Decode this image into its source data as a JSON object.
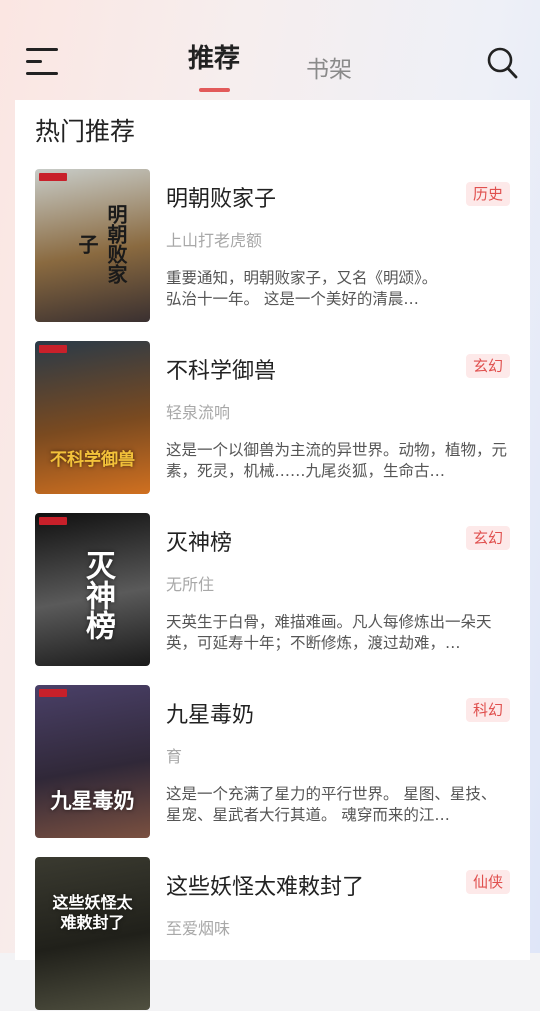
{
  "header": {
    "tabs": [
      {
        "label": "推荐",
        "active": true
      },
      {
        "label": "书架",
        "active": false
      }
    ],
    "accent_color": "#e25a5a"
  },
  "section": {
    "title": "热门推荐"
  },
  "books": [
    {
      "title": "明朝败家子",
      "author": "上山打老虎额",
      "tag": "历史",
      "desc": "重要通知，明朝败家子，又名《明颂》。\n        弘治十一年。        这是一个美好的清晨…",
      "cover_text": "明朝败家子",
      "cover_colors": [
        "#c8ccc8",
        "#8a6a40",
        "#3a3030"
      ]
    },
    {
      "title": "不科学御兽",
      "author": "轻泉流响",
      "tag": "玄幻",
      "desc": "这是一个以御兽为主流的异世界。动物，植物，元素，死灵，机械……九尾炎狐，生命古…",
      "cover_text": "不科学御兽",
      "cover_colors": [
        "#2a3a48",
        "#7a4a20",
        "#d07020"
      ]
    },
    {
      "title": "灭神榜",
      "author": "无所住",
      "tag": "玄幻",
      "desc": "天英生于白骨，难描难画。凡人每修炼出一朵天英，可延寿十年；不断修炼，渡过劫难，…",
      "cover_text": "灭神榜",
      "cover_colors": [
        "#101010",
        "#5a5a5a",
        "#1a1a1a"
      ]
    },
    {
      "title": "九星毒奶",
      "author": "育",
      "tag": "科幻",
      "desc": "这是一个充满了星力的平行世界。 星图、星技、星宠、星武者大行其道。 魂穿而来的江…",
      "cover_text": "九星毒奶",
      "cover_colors": [
        "#4a4068",
        "#302838",
        "#7a5040"
      ]
    },
    {
      "title": "这些妖怪太难敕封了",
      "author": "至爱烟味",
      "tag": "仙侠",
      "desc": "",
      "cover_text": "这些妖怪太难敕封了",
      "cover_colors": [
        "#3a3a30",
        "#20201a",
        "#505040"
      ]
    }
  ]
}
